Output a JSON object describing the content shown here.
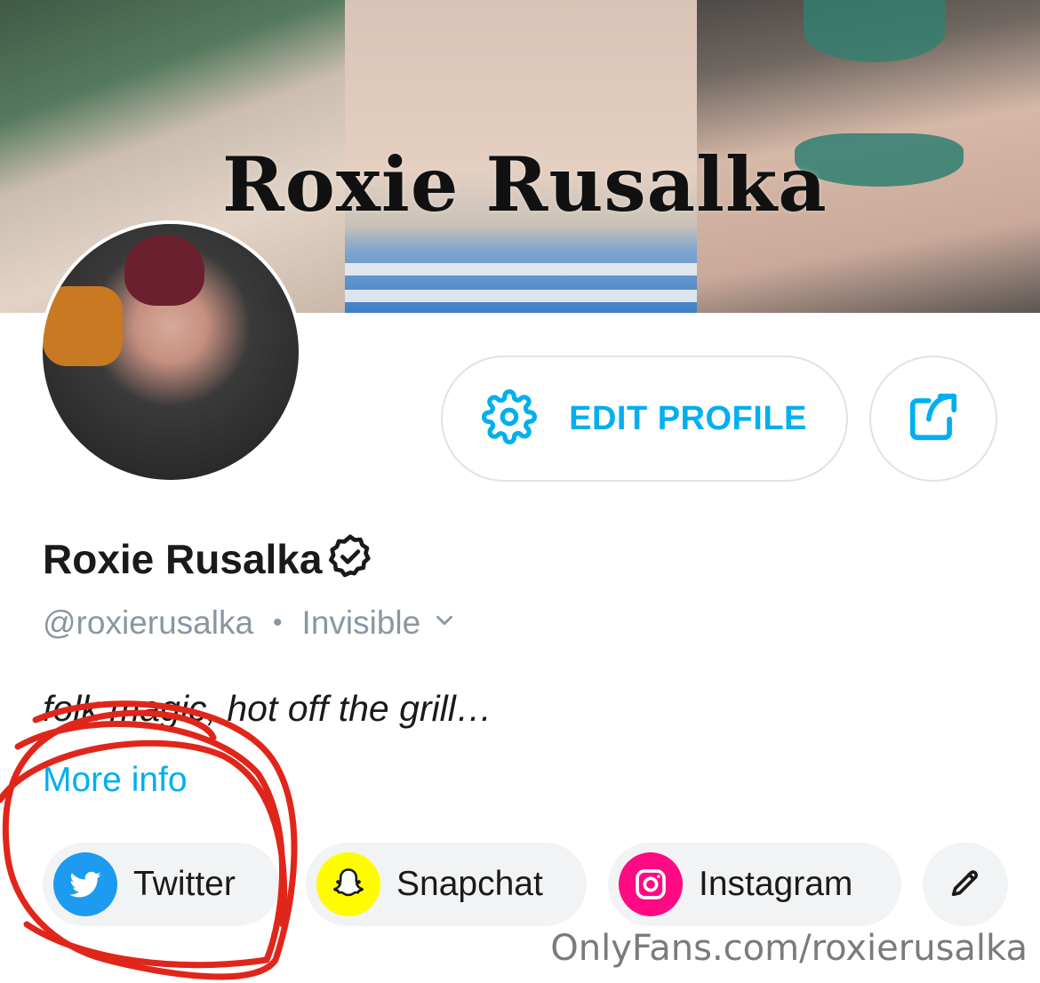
{
  "banner": {
    "title": "Roxie Rusalka"
  },
  "profile": {
    "name": "Roxie Rusalka",
    "handle": "@roxierusalka",
    "separator": "•",
    "status": "Invisible",
    "bio": "folk magic, hot off the grill…",
    "more_info": "More info",
    "verified": true
  },
  "actions": {
    "edit_profile": "EDIT PROFILE"
  },
  "socials": [
    {
      "label": "Twitter",
      "icon": "twitter-icon",
      "color": "#1d9bf0"
    },
    {
      "label": "Snapchat",
      "icon": "snapchat-icon",
      "color": "#fffc00"
    },
    {
      "label": "Instagram",
      "icon": "instagram-icon",
      "color": "#ff0a84"
    }
  ],
  "watermark": "OnlyFans.com/roxierusalka",
  "colors": {
    "accent": "#00aff0",
    "muted": "#8a96a3",
    "chip_bg": "#f1f3f4",
    "annotation": "#e0261b"
  }
}
